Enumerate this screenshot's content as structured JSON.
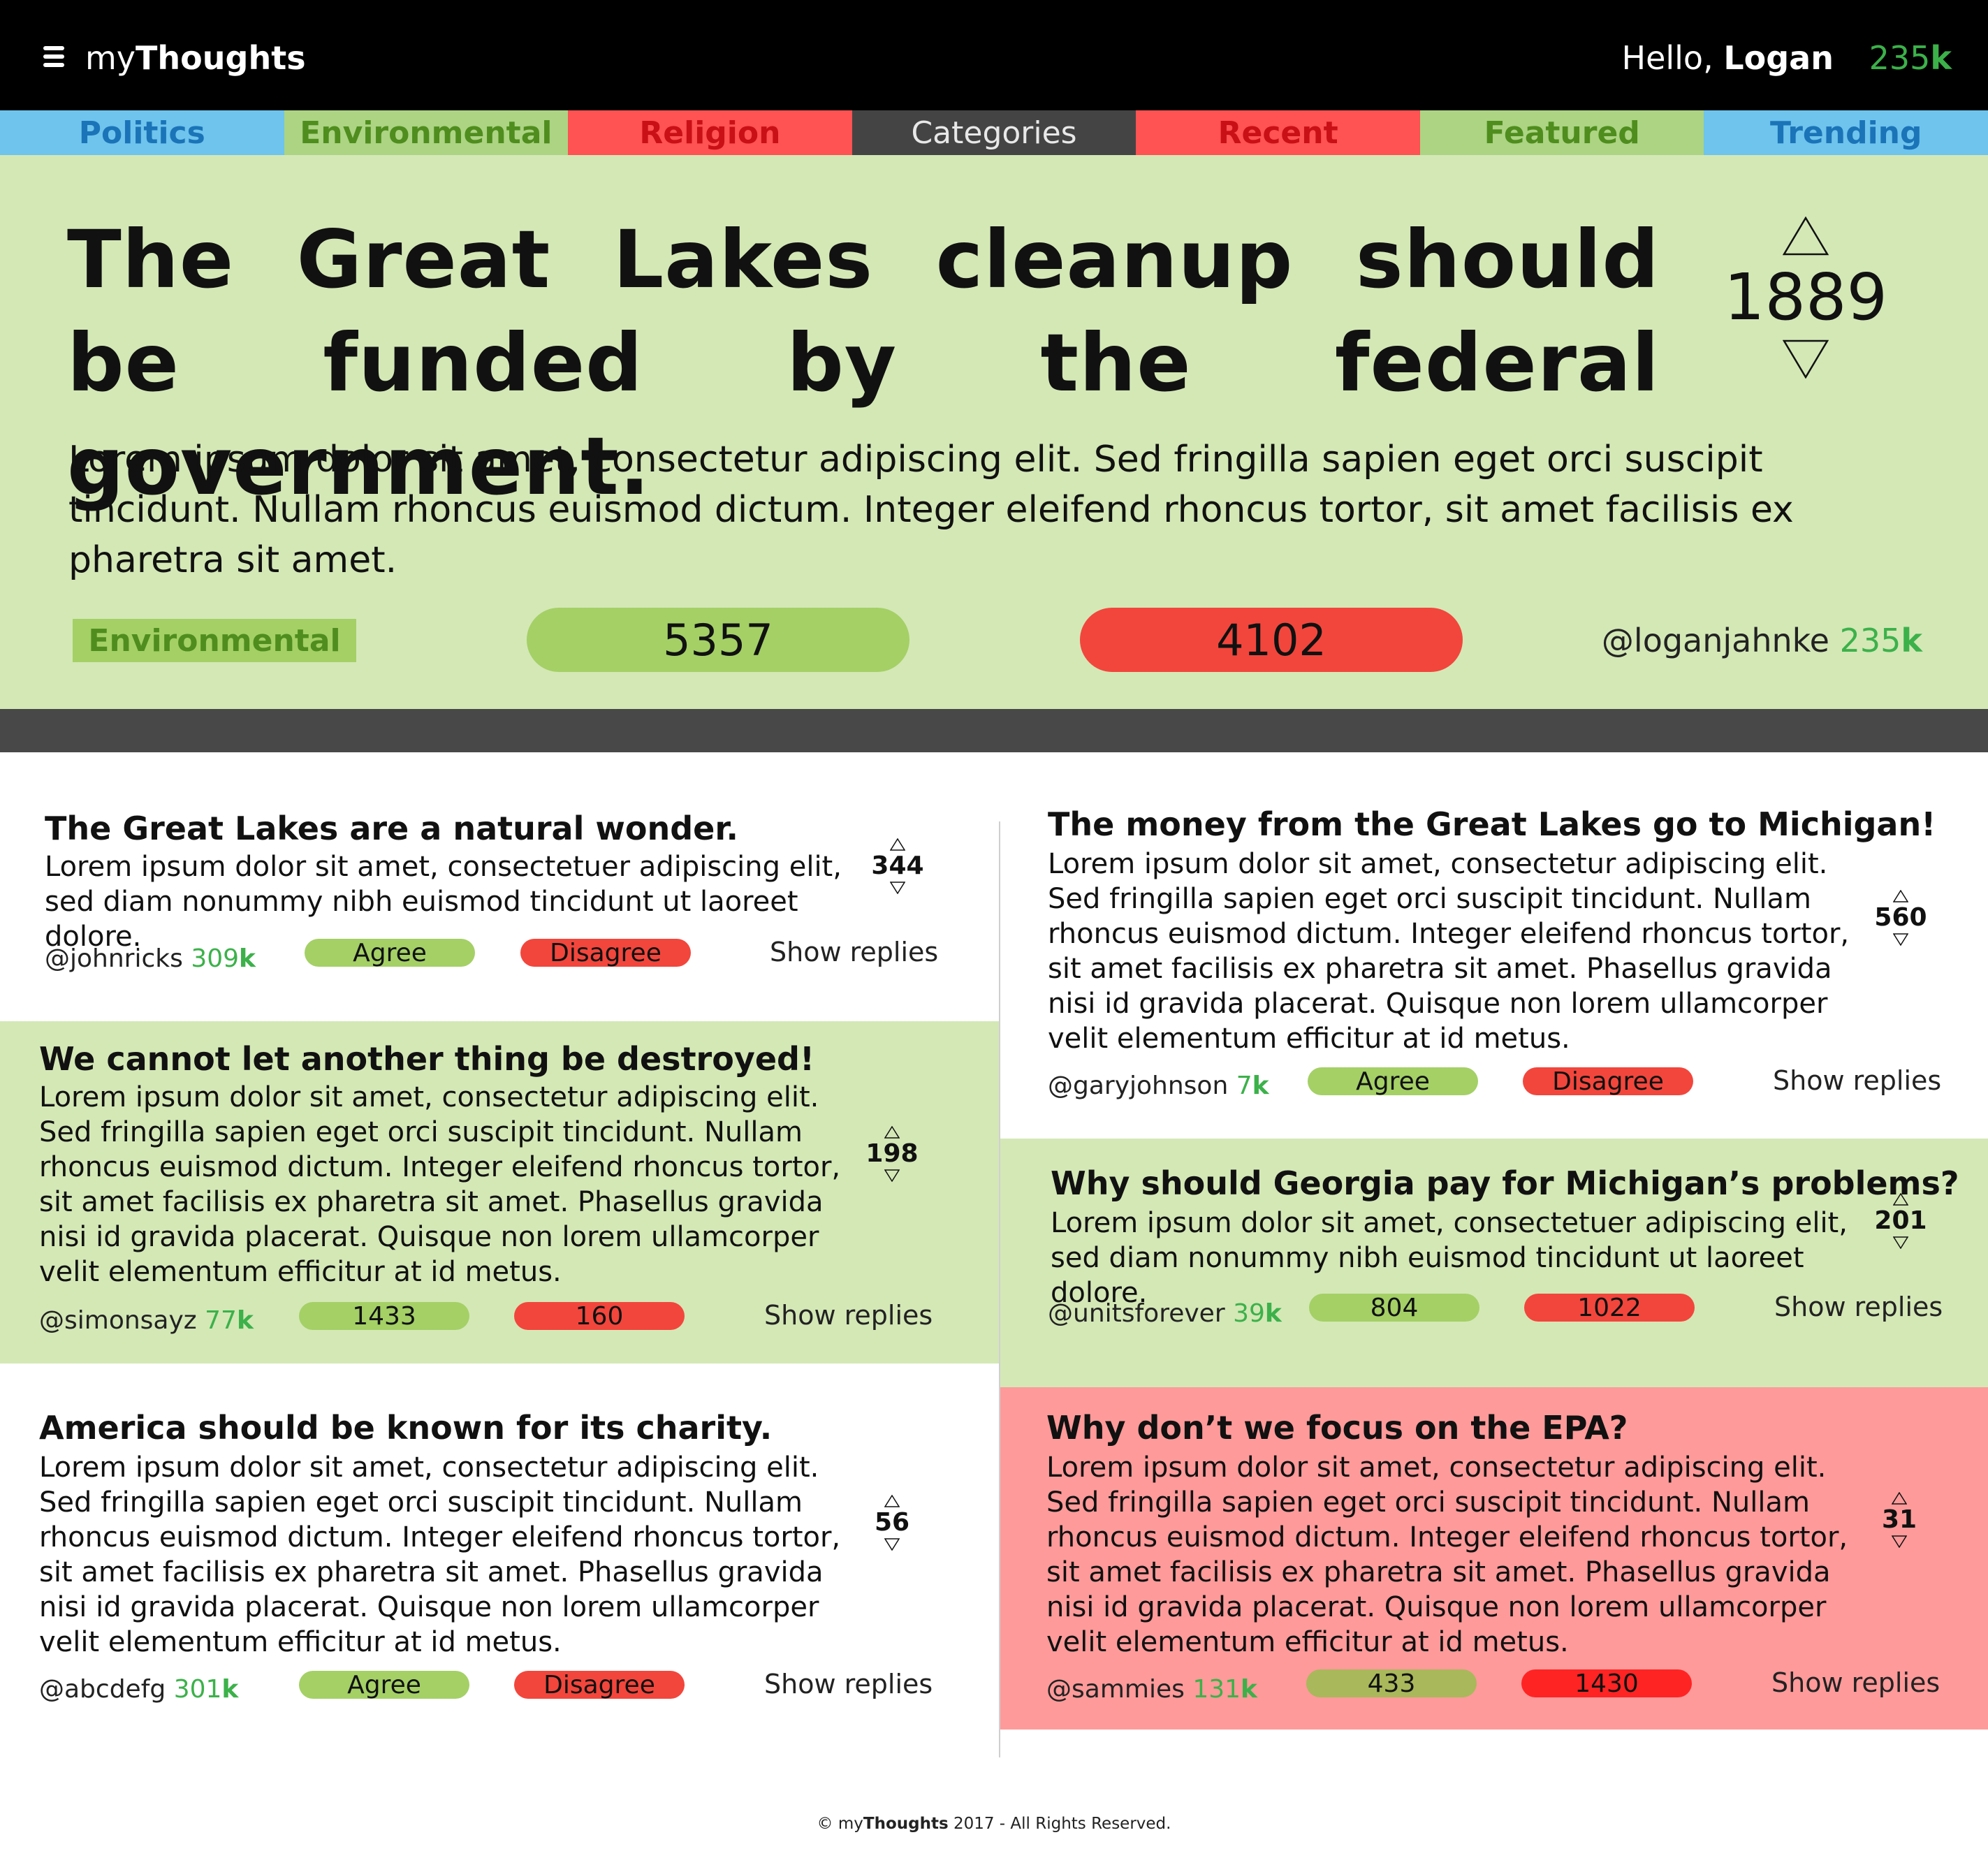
{
  "header": {
    "brand_prefix": "my",
    "brand_bold": "Thoughts",
    "greeting_prefix": "Hello,",
    "user_name": "Logan",
    "karma_number": "235",
    "karma_suffix": "k"
  },
  "nav": {
    "categories": [
      "Politics",
      "Environmental",
      "Religion",
      "Categories",
      "Recent",
      "Featured",
      "Trending"
    ]
  },
  "hero": {
    "title": "The Great Lakes cleanup should be funded by the federal government.",
    "votes": "1889",
    "body": "Lorem ipsum dolor sit amet, consectetur adipiscing elit. Sed fringilla sapien eget orci suscipit tincidunt. Nullam rhoncus euismod dictum. Integer eleifend rhoncus tortor, sit amet facilisis ex pharetra sit amet.",
    "category": "Environmental",
    "agree_count": "5357",
    "disagree_count": "4102",
    "author": "@loganjahnke",
    "author_karma": "235",
    "author_karma_suffix": "k"
  },
  "comments": [
    {
      "title": "The Great Lakes are a natural wonder.",
      "body": "Lorem ipsum dolor sit amet, consectetuer adipiscing elit, sed diam nonummy nibh euismod tincidunt ut laoreet dolore.",
      "votes": "344",
      "author": "@johnricks",
      "karma": "309",
      "karma_suffix": "k",
      "agree": "Agree",
      "disagree": "Disagree",
      "replies": "Show replies"
    },
    {
      "title": "We cannot let another thing be destroyed!",
      "body": "Lorem ipsum dolor sit amet, consectetur adipiscing elit. Sed fringilla sapien eget orci suscipit tincidunt. Nullam rhoncus euismod dictum. Integer eleifend rhoncus tortor, sit amet facilisis ex pharetra sit amet. Phasellus gravida nisi id gravida placerat. Quisque non lorem ullamcorper velit elementum efficitur at id metus.",
      "votes": "198",
      "author": "@simonsayz",
      "karma": "77",
      "karma_suffix": "k",
      "agree": "1433",
      "disagree": "160",
      "replies": "Show replies"
    },
    {
      "title": "America should be known for its charity.",
      "body": "Lorem ipsum dolor sit amet, consectetur adipiscing elit. Sed fringilla sapien eget orci suscipit tincidunt. Nullam rhoncus euismod dictum. Integer eleifend rhoncus tortor, sit amet facilisis ex pharetra sit amet. Phasellus gravida nisi id gravida placerat. Quisque non lorem ullamcorper velit elementum efficitur at id metus.",
      "votes": "56",
      "author": "@abcdefg",
      "karma": "301",
      "karma_suffix": "k",
      "agree": "Agree",
      "disagree": "Disagree",
      "replies": "Show replies"
    },
    {
      "title": "The money from the Great Lakes go to Michigan!",
      "body": "Lorem ipsum dolor sit amet, consectetur adipiscing elit. Sed fringilla sapien eget orci suscipit tincidunt. Nullam rhoncus euismod dictum. Integer eleifend rhoncus tortor, sit amet facilisis ex pharetra sit amet. Phasellus gravida nisi id gravida placerat. Quisque non lorem ullamcorper velit elementum efficitur at id metus.",
      "votes": "560",
      "author": "@garyjohnson",
      "karma": "7",
      "karma_suffix": "k",
      "agree": "Agree",
      "disagree": "Disagree",
      "replies": "Show replies"
    },
    {
      "title": "Why should Georgia pay for Michigan’s problems?",
      "body": "Lorem ipsum dolor sit amet, consectetuer adipiscing elit, sed diam nonummy nibh euismod tincidunt ut laoreet dolore.",
      "votes": "201",
      "author": "@unitsforever",
      "karma": "39",
      "karma_suffix": "k",
      "agree": "804",
      "disagree": "1022",
      "replies": "Show replies"
    },
    {
      "title": "Why don’t we focus on the EPA?",
      "body": "Lorem ipsum dolor sit amet, consectetur adipiscing elit. Sed fringilla sapien eget orci suscipit tincidunt. Nullam rhoncus euismod dictum. Integer eleifend rhoncus tortor, sit amet facilisis ex pharetra sit amet. Phasellus gravida nisi id gravida placerat. Quisque non lorem ullamcorper velit elementum efficitur at id metus.",
      "votes": "31",
      "author": "@sammies",
      "karma": "131",
      "karma_suffix": "k",
      "agree": "433",
      "disagree": "1430",
      "replies": "Show replies"
    }
  ],
  "footer": {
    "copyright": "©",
    "brand_prefix": "my",
    "brand_bold": "Thoughts",
    "rest": "2017 - All Rights Reserved."
  },
  "icons": {
    "menu": "hamburger-menu-icon",
    "upvote": "upvote-triangle-icon",
    "downvote": "downvote-triangle-icon"
  },
  "colors": {
    "politics": "#6ec4ec",
    "environmental": "#acd483",
    "religion": "#ff5252",
    "categories": "#444444",
    "hero_background": "#d4e8b6",
    "agree": "#a4d066",
    "disagree": "#f2463c",
    "karma_green": "#3cb14a",
    "red_card": "#ff9a9a"
  }
}
